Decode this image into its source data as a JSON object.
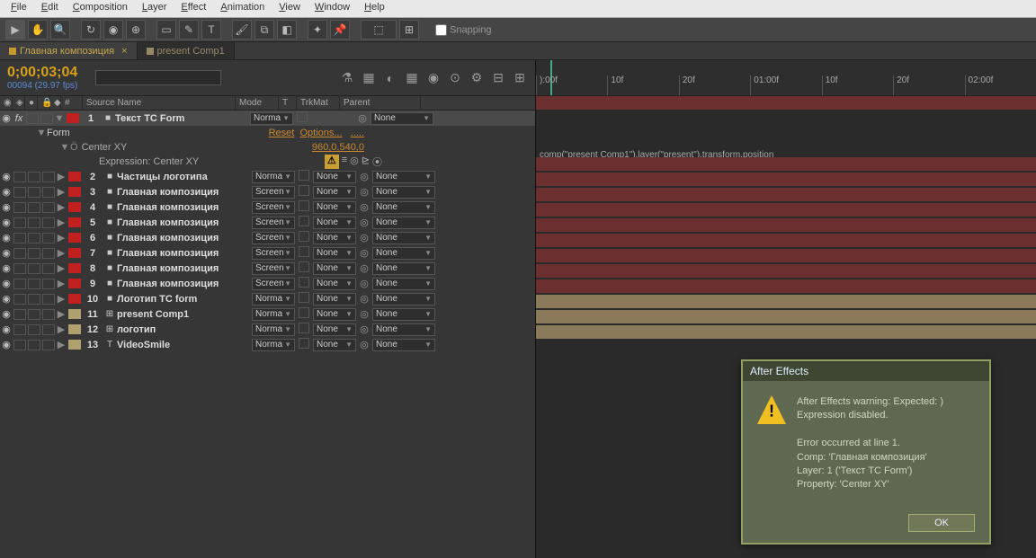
{
  "menu": [
    "File",
    "Edit",
    "Composition",
    "Layer",
    "Effect",
    "Animation",
    "View",
    "Window",
    "Help"
  ],
  "snapping": "Snapping",
  "tabs": [
    {
      "label": "Главная композиция",
      "color": "#c89830",
      "active": true,
      "close": "×"
    },
    {
      "label": "present Comp1",
      "color": "#998866",
      "active": false,
      "close": ""
    }
  ],
  "timecode": "0;00;03;04",
  "frameinfo": "00094 (29.97 fps)",
  "columns": {
    "source": "Source Name",
    "mode": "Mode",
    "t": "T",
    "trkmat": "TrkMat",
    "parent": "Parent"
  },
  "form": {
    "label": "Form",
    "reset": "Reset",
    "options": "Options...",
    "dots": ".....",
    "centerLabel": "Center XY",
    "centerVal": "960,0,540,0",
    "exprLabel": "Expression: Center XY"
  },
  "expressionText": "comp(\"present Comp1\").layer(\"present\").transform.position",
  "layers": [
    {
      "num": 1,
      "name": "Текст TC Form",
      "mode": "Norma",
      "trkmat": "",
      "parent": "None",
      "color": "#c02020",
      "sel": true,
      "icon": "■",
      "hasT": true,
      "twOpen": true,
      "fx": true
    },
    {
      "num": 2,
      "name": "Частицы логотипа",
      "mode": "Norma",
      "trkmat": "None",
      "parent": "None",
      "color": "#c02020",
      "icon": "■",
      "hasT": true
    },
    {
      "num": 3,
      "name": "Главная композиция",
      "mode": "Screen",
      "trkmat": "None",
      "parent": "None",
      "color": "#c02020",
      "icon": "■",
      "hasT": true
    },
    {
      "num": 4,
      "name": "Главная композиция",
      "mode": "Screen",
      "trkmat": "None",
      "parent": "None",
      "color": "#c02020",
      "icon": "■",
      "hasT": true
    },
    {
      "num": 5,
      "name": "Главная композиция",
      "mode": "Screen",
      "trkmat": "None",
      "parent": "None",
      "color": "#c02020",
      "icon": "■",
      "hasT": true
    },
    {
      "num": 6,
      "name": "Главная композиция",
      "mode": "Screen",
      "trkmat": "None",
      "parent": "None",
      "color": "#c02020",
      "icon": "■",
      "hasT": true
    },
    {
      "num": 7,
      "name": "Главная композиция",
      "mode": "Screen",
      "trkmat": "None",
      "parent": "None",
      "color": "#c02020",
      "icon": "■",
      "hasT": true
    },
    {
      "num": 8,
      "name": "Главная композиция",
      "mode": "Screen",
      "trkmat": "None",
      "parent": "None",
      "color": "#c02020",
      "icon": "■",
      "hasT": true
    },
    {
      "num": 9,
      "name": "Главная композиция",
      "mode": "Screen",
      "trkmat": "None",
      "parent": "None",
      "color": "#c02020",
      "icon": "■",
      "hasT": true
    },
    {
      "num": 10,
      "name": "Логотип TC form",
      "mode": "Norma",
      "trkmat": "None",
      "parent": "None",
      "color": "#c02020",
      "icon": "■",
      "hasT": true
    },
    {
      "num": 11,
      "name": "present Comp1",
      "mode": "Norma",
      "trkmat": "None",
      "parent": "None",
      "color": "#b0a070",
      "icon": "⊞",
      "hasT": true,
      "tan": true
    },
    {
      "num": 12,
      "name": "логотип",
      "mode": "Norma",
      "trkmat": "None",
      "parent": "None",
      "color": "#b0a070",
      "icon": "⊞",
      "hasT": true,
      "tan": true
    },
    {
      "num": 13,
      "name": "VideoSmile",
      "mode": "Norma",
      "trkmat": "None",
      "parent": "None",
      "color": "#b0a070",
      "icon": "T",
      "hasT": true,
      "tan": true
    }
  ],
  "ruler": [
    "):00f",
    "10f",
    "20f",
    "01:00f",
    "10f",
    "20f",
    "02:00f"
  ],
  "dialog": {
    "title": "After Effects",
    "line1": "After Effects warning: Expected: )",
    "line2": "Expression disabled.",
    "line3": "Error occurred at line 1.",
    "line4": "Comp: 'Главная композиция'",
    "line5": "Layer: 1 ('Текст TC Form')",
    "line6": "Property: 'Center XY'",
    "ok": "OK"
  }
}
